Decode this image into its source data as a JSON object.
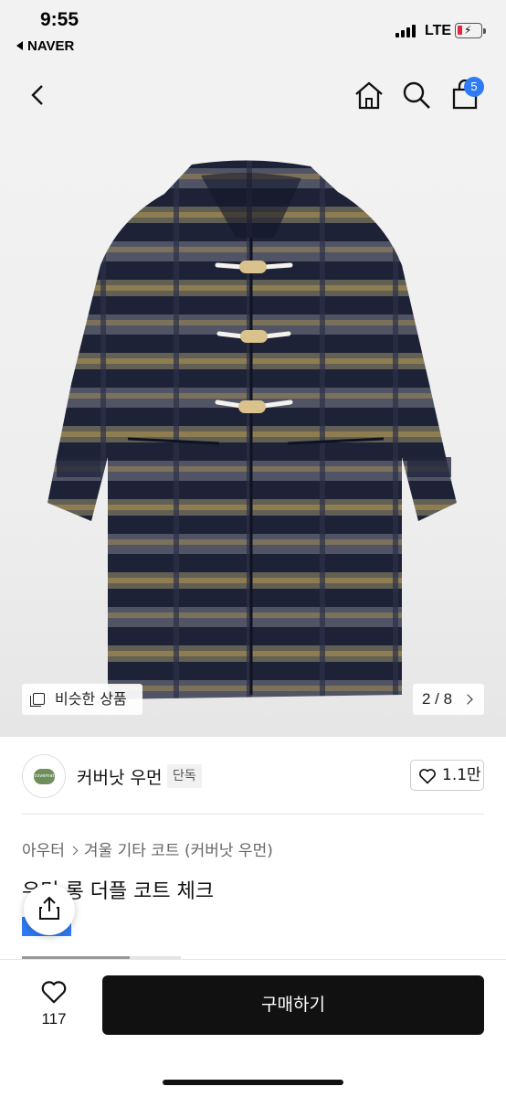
{
  "status_bar": {
    "time": "9:55",
    "back_app": "NAVER",
    "network": "LTE"
  },
  "nav": {
    "back_icon": "chevron-left-icon",
    "home_icon": "home-icon",
    "search_icon": "search-icon",
    "cart_icon": "cart-icon",
    "cart_count": "5"
  },
  "product": {
    "image_alt": "duffle coat",
    "similar_label": "비슷한 상품",
    "page_indicator": "2 / 8",
    "brand_name": "커버낫 우먼",
    "exclusive_label": "단독",
    "like_count": "1.1만",
    "breadcrumb": [
      "아우터",
      "겨울 기타 코트 (커버낫 우먼)"
    ],
    "title": "우먼 롱 더플 코트 체크"
  },
  "bottom": {
    "wish_count": "117",
    "buy_label": "구매하기"
  },
  "colors": {
    "accent": "#2f7bf5",
    "buy_button": "#111111",
    "battery_low": "#e0283b"
  }
}
